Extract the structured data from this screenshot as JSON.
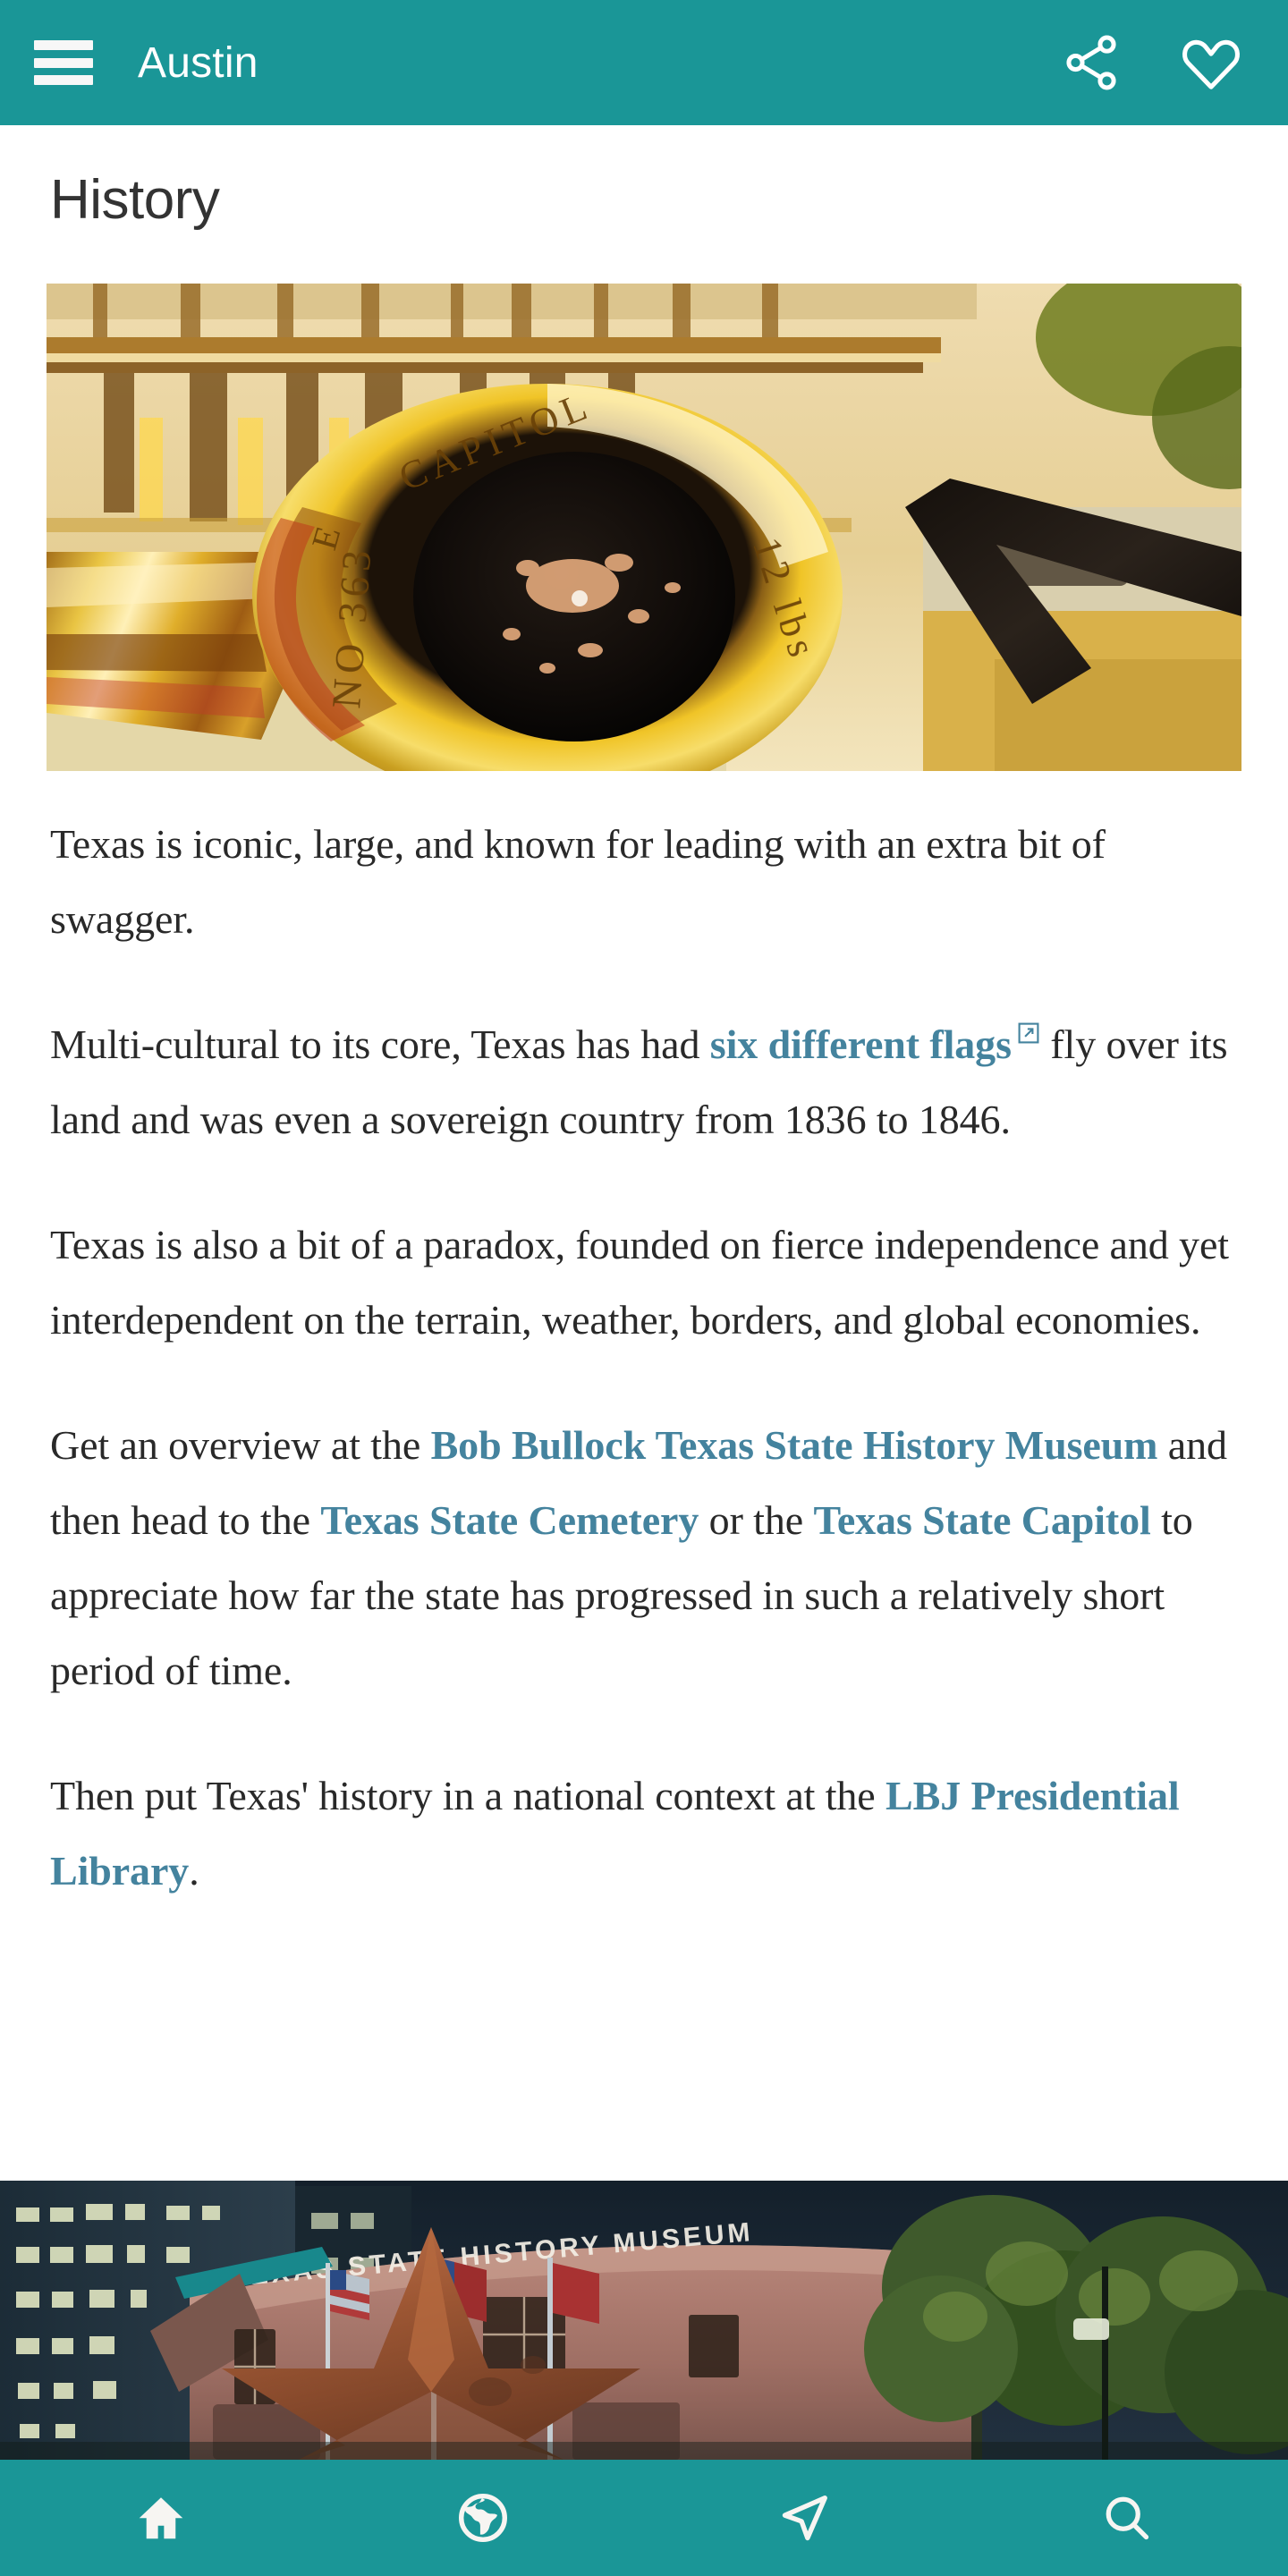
{
  "topbar": {
    "menu_icon": "hamburger-menu-icon",
    "title": "Austin",
    "share_icon": "share-icon",
    "favorite_icon": "heart-icon"
  },
  "page": {
    "title": "History"
  },
  "hero_image": {
    "alt": "Close-up of a bronze cannon muzzle inscribed THE CAPITOL NO 363 12 lbs in front of the Texas State Capitol building",
    "inscriptions": [
      "CAPITOL",
      "NO 363",
      "12 lbs"
    ]
  },
  "article": {
    "paragraphs": [
      {
        "id": "p1",
        "segments": [
          {
            "type": "text",
            "value": "Texas is iconic, large, and known for leading with an extra bit of swagger."
          }
        ]
      },
      {
        "id": "p2",
        "segments": [
          {
            "type": "text",
            "value": "Multi-cultural to its core, Texas has had "
          },
          {
            "type": "link",
            "value": "six different flags",
            "external": true
          },
          {
            "type": "text",
            "value": " fly over its land and was even a sovereign country from 1836 to 1846."
          }
        ]
      },
      {
        "id": "p3",
        "segments": [
          {
            "type": "text",
            "value": "Texas is also a bit of a paradox, founded on fierce independence and yet interdependent on the terrain, weather, borders, and global economies."
          }
        ]
      },
      {
        "id": "p4",
        "segments": [
          {
            "type": "text",
            "value": "Get an overview at the "
          },
          {
            "type": "link",
            "value": "Bob Bullock Texas State History Museum",
            "external": false
          },
          {
            "type": "text",
            "value": " and then head to the "
          },
          {
            "type": "link",
            "value": "Texas State Cemetery",
            "external": false
          },
          {
            "type": "text",
            "value": " or the "
          },
          {
            "type": "link",
            "value": "Texas State Capitol",
            "external": false
          },
          {
            "type": "text",
            "value": " to appreciate how far the state has progressed in such a relatively short period of time."
          }
        ]
      },
      {
        "id": "p5",
        "segments": [
          {
            "type": "text",
            "value": "Then put Texas' history in a national context at the "
          },
          {
            "type": "link",
            "value": "LBJ Presidential Library",
            "external": false
          },
          {
            "type": "text",
            "value": "."
          }
        ]
      }
    ]
  },
  "footer_image": {
    "alt": "Bob Bullock Texas State History Museum at dusk with a large rusted Texas star sculpture in front",
    "building_sign": "TEXAS STATE HISTORY MUSEUM"
  },
  "bottomnav": {
    "items": [
      {
        "icon": "home-icon",
        "label": "Home"
      },
      {
        "icon": "globe-icon",
        "label": "Explore"
      },
      {
        "icon": "navigation-arrow-icon",
        "label": "Navigate"
      },
      {
        "icon": "search-icon",
        "label": "Search"
      }
    ]
  },
  "colors": {
    "brand_teal": "#1A9697",
    "link_blue": "#44839E",
    "body_text": "#292929",
    "title_text": "#333333",
    "bar_text": "#FFFFFF"
  }
}
